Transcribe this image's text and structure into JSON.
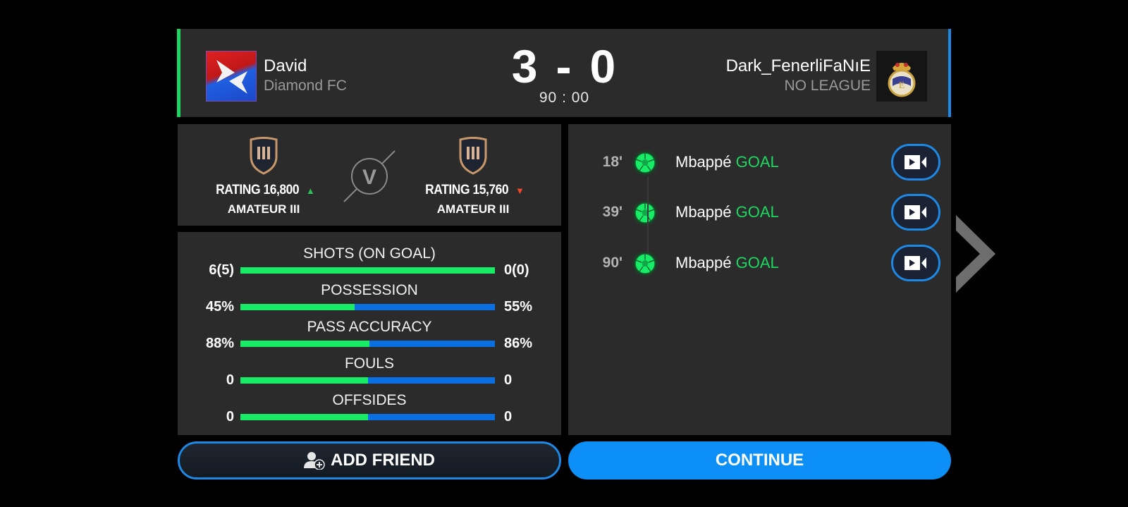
{
  "header": {
    "home": {
      "name": "David",
      "league": "Diamond FC",
      "crest": "diamond-fc-crest-icon",
      "accent": "#1ed760"
    },
    "away": {
      "name": "Dark_FenerliFaNıE",
      "league": "NO LEAGUE",
      "crest": "real-madrid-crest-icon",
      "accent": "#1e88e5"
    },
    "score_home": "3",
    "score_sep": "-",
    "score_away": "0",
    "clock": "90 : 00"
  },
  "ranks": {
    "home": {
      "rating_label": "RATING 16,800",
      "trend": "up",
      "trend_glyph": "▲",
      "tier": "AMATEUR III"
    },
    "away": {
      "rating_label": "RATING 15,760",
      "trend": "down",
      "trend_glyph": "▼",
      "tier": "AMATEUR III"
    },
    "vs_label": "V"
  },
  "stats": [
    {
      "label": "SHOTS (ON GOAL)",
      "home": "6(5)",
      "away": "0(0)",
      "home_share": 1.0
    },
    {
      "label": "POSSESSION",
      "home": "45%",
      "away": "55%",
      "home_share": 0.45
    },
    {
      "label": "PASS ACCURACY",
      "home": "88%",
      "away": "86%",
      "home_share": 0.506
    },
    {
      "label": "FOULS",
      "home": "0",
      "away": "0",
      "home_share": 0.5
    },
    {
      "label": "OFFSIDES",
      "home": "0",
      "away": "0",
      "home_share": 0.5
    }
  ],
  "events": [
    {
      "minute": "18'",
      "player": "Mbappé",
      "type": "GOAL"
    },
    {
      "minute": "39'",
      "player": "Mbappé",
      "type": "GOAL"
    },
    {
      "minute": "90'",
      "player": "Mbappé",
      "type": "GOAL"
    }
  ],
  "colors": {
    "home_bar": "#18ec66",
    "away_bar": "#0a6fe0",
    "primary_button": "#0c8ff6"
  },
  "buttons": {
    "add_friend": "ADD FRIEND",
    "continue": "CONTINUE"
  }
}
